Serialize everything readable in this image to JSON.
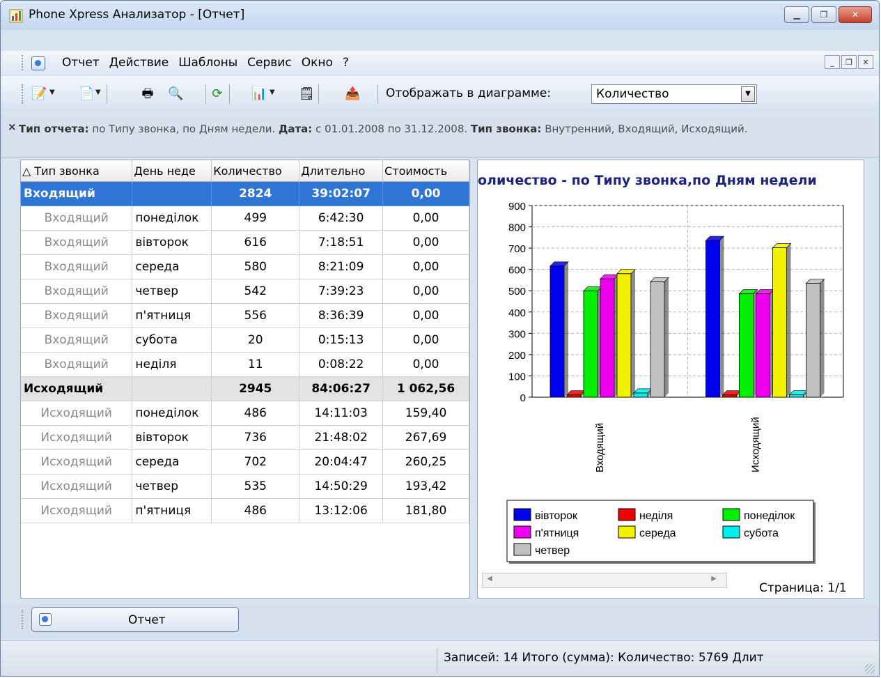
{
  "window": {
    "title": "Phone Xpress Анализатор - [Отчет]"
  },
  "menu": {
    "items": [
      "Отчет",
      "Действие",
      "Шаблоны",
      "Сервис",
      "Окно",
      "?"
    ]
  },
  "toolbar": {
    "show_label": "Отображать в диаграмме:",
    "show_value": "Количество"
  },
  "filter": {
    "close": "×",
    "k1": "Тип отчета:",
    "v1": " по Типу звонка, по Дням недели. ",
    "k2": "Дата:",
    "v2": " с 01.01.2008 по 31.12.2008. ",
    "k3": "Тип звонка:",
    "v3": " Внутренний, Входящий, Исходящий."
  },
  "table": {
    "columns": [
      "△ Тип звонка",
      "День неде",
      "Количество",
      "Длительно",
      "Стоимость"
    ],
    "rows": [
      {
        "kind": "sel",
        "cells": [
          "Входящий",
          "",
          "2824",
          "39:02:07",
          "0,00"
        ]
      },
      {
        "kind": "",
        "cells": [
          "Входящий",
          "понеділок",
          "499",
          "6:42:30",
          "0,00"
        ]
      },
      {
        "kind": "",
        "cells": [
          "Входящий",
          "вівторок",
          "616",
          "7:18:51",
          "0,00"
        ]
      },
      {
        "kind": "",
        "cells": [
          "Входящий",
          "середа",
          "580",
          "8:21:09",
          "0,00"
        ]
      },
      {
        "kind": "",
        "cells": [
          "Входящий",
          "четвер",
          "542",
          "7:39:23",
          "0,00"
        ]
      },
      {
        "kind": "",
        "cells": [
          "Входящий",
          "п'ятниця",
          "556",
          "8:36:39",
          "0,00"
        ]
      },
      {
        "kind": "",
        "cells": [
          "Входящий",
          "субота",
          "20",
          "0:15:13",
          "0,00"
        ]
      },
      {
        "kind": "",
        "cells": [
          "Входящий",
          "неділя",
          "11",
          "0:08:22",
          "0,00"
        ]
      },
      {
        "kind": "group",
        "cells": [
          "Исходящий",
          "",
          "2945",
          "84:06:27",
          "1 062,56"
        ]
      },
      {
        "kind": "",
        "cells": [
          "Исходящий",
          "понеділок",
          "486",
          "14:11:03",
          "159,40"
        ]
      },
      {
        "kind": "",
        "cells": [
          "Исходящий",
          "вівторок",
          "736",
          "21:48:02",
          "267,69"
        ]
      },
      {
        "kind": "",
        "cells": [
          "Исходящий",
          "середа",
          "702",
          "20:04:47",
          "260,25"
        ]
      },
      {
        "kind": "",
        "cells": [
          "Исходящий",
          "четвер",
          "535",
          "14:50:29",
          "193,42"
        ]
      },
      {
        "kind": "",
        "cells": [
          "Исходящий",
          "п'ятниця",
          "486",
          "13:12:06",
          "181,80"
        ]
      }
    ]
  },
  "chart_data": {
    "type": "bar",
    "title": "оличество - по Типу звонка,по Дням недели",
    "categories": [
      "Входящий",
      "Исходящий"
    ],
    "ylim": [
      0,
      900
    ],
    "yticks": [
      0,
      100,
      200,
      300,
      400,
      500,
      600,
      700,
      800,
      900
    ],
    "grid": true,
    "legend_position": "bottom",
    "series": [
      {
        "name": "вівторок",
        "values": [
          616,
          736
        ],
        "color": "#0000ee"
      },
      {
        "name": "неділя",
        "values": [
          11,
          11
        ],
        "color": "#ee0000"
      },
      {
        "name": "понеділок",
        "values": [
          499,
          486
        ],
        "color": "#00ee00"
      },
      {
        "name": "п'ятниця",
        "values": [
          556,
          486
        ],
        "color": "#ee00ee"
      },
      {
        "name": "середа",
        "values": [
          580,
          702
        ],
        "color": "#f2f200"
      },
      {
        "name": "субота",
        "values": [
          20,
          11
        ],
        "color": "#00eeee"
      },
      {
        "name": "четвер",
        "values": [
          542,
          535
        ],
        "color": "#c0c0c0"
      }
    ]
  },
  "pager": {
    "label": "Страница: 1/1"
  },
  "tab": {
    "label": "Отчет"
  },
  "status": {
    "text": "Записей: 14  Итого (сумма):  Количество: 5769  Длит"
  }
}
